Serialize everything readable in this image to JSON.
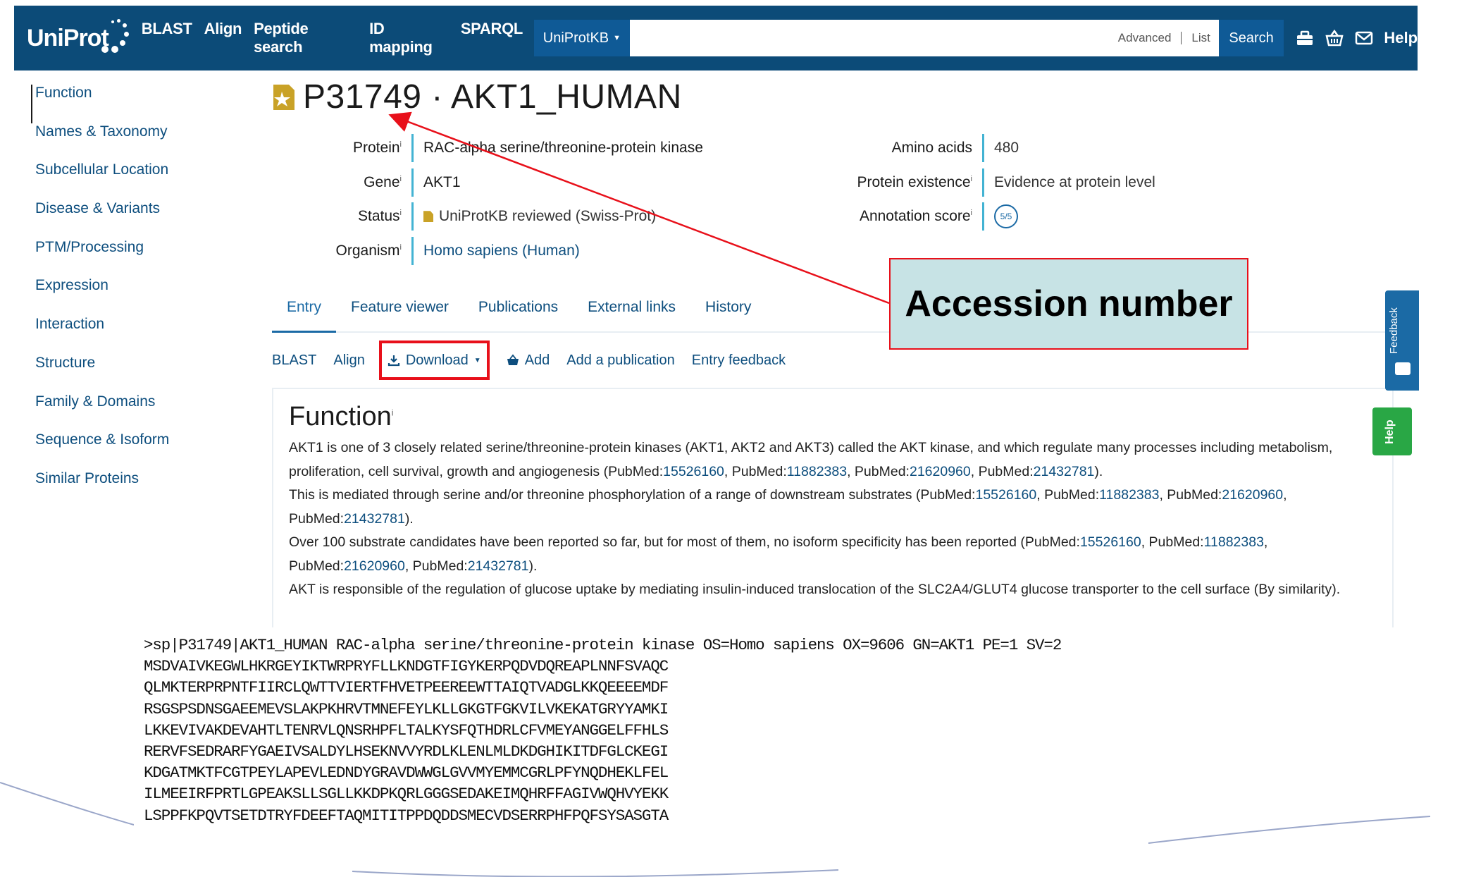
{
  "topbar": {
    "logo": "UniProt",
    "nav": [
      "BLAST",
      "Align",
      "Peptide search",
      "ID mapping",
      "SPARQL"
    ],
    "database": "UniProtKB",
    "search_value": "",
    "advanced": "Advanced",
    "list": "List",
    "search_button": "Search",
    "help": "Help"
  },
  "sidebar": {
    "items": [
      "Function",
      "Names & Taxonomy",
      "Subcellular Location",
      "Disease & Variants",
      "PTM/Processing",
      "Expression",
      "Interaction",
      "Structure",
      "Family & Domains",
      "Sequence & Isoform",
      "Similar Proteins"
    ]
  },
  "entry": {
    "title": "P31749 · AKT1_HUMAN",
    "left": [
      {
        "label": "Protein",
        "value": "RAC-alpha serine/threonine-protein kinase"
      },
      {
        "label": "Gene",
        "value": "AKT1"
      },
      {
        "label": "Status",
        "value": "UniProtKB reviewed (Swiss-Prot)"
      },
      {
        "label": "Organism",
        "value": "Homo sapiens (Human)"
      }
    ],
    "right": [
      {
        "label": "Amino acids",
        "value": "480"
      },
      {
        "label": "Protein existence",
        "value": "Evidence at protein level"
      },
      {
        "label": "Annotation score",
        "value": "5/5"
      }
    ]
  },
  "tabs": [
    "Entry",
    "Feature viewer",
    "Publications",
    "External links",
    "History"
  ],
  "toolbar": {
    "blast": "BLAST",
    "align": "Align",
    "download": "Download",
    "add": "Add",
    "add_publication": "Add a publication",
    "entry_feedback": "Entry feedback"
  },
  "function": {
    "heading": "Function",
    "paragraphs": [
      "AKT1 is one of 3 closely related serine/threonine-protein kinases (AKT1, AKT2 and AKT3) called the AKT kinase, and which regulate many processes including metabolism, proliferation, cell survival, growth and angiogenesis (PubMed:15526160, PubMed:11882383, PubMed:21620960, PubMed:21432781).",
      "This is mediated through serine and/or threonine phosphorylation of a range of downstream substrates (PubMed:15526160, PubMed:11882383, PubMed:21620960, PubMed:21432781).",
      "Over 100 substrate candidates have been reported so far, but for most of them, no isoform specificity has been reported (PubMed:15526160, PubMed:11882383, PubMed:21620960, PubMed:21432781).",
      "AKT is responsible of the regulation of glucose uptake by mediating insulin-induced translocation of the SLC2A4/GLUT4 glucose transporter to the cell surface (By similarity)."
    ]
  },
  "side_tabs": {
    "feedback": "Feedback",
    "help": "Help"
  },
  "annotation": {
    "label": "Accession number",
    "color": "#e8101a"
  },
  "fasta": {
    "header": ">sp|P31749|AKT1_HUMAN RAC-alpha serine/threonine-protein kinase OS=Homo sapiens OX=9606 GN=AKT1 PE=1 SV=2",
    "lines": [
      "MSDVAIVKEGWLHKRGEYIKTWRPRYFLLKNDGTFIGYKERPQDVDQREAPLNNFSVAQC",
      "QLMKTERPRPNTFIIRCLQWTTVIERTFHVETPEEREEWTTAIQTVADGLKKQEEEEMDF",
      "RSGSPSDNSGAEEMEVSLAKPKHRVTMNEFEYLKLLGKGTFGKVILVKEKATGRYYAMKI",
      "LKKEVIVAKDEVAHTLTENRVLQNSRHPFLTALKYSFQTHDRLCFVMEYANGGELFFHLS",
      "RERVFSEDRARFYGAEIVSALDYLHSEKNVVYRDLKLENLMLDKDGHIKITDFGLCKEGI",
      "KDGATMKTFCGTPEYLAPEVLEDNDYGRAVDWWGLGVVMYEMMCGRLPFYNQDHEKLFEL",
      "ILMEEIRFPRTLGPEAKSLLSGLLKKDPKQRLGGGSEDAKEIMQHRFFAGIVWQHVYEKK",
      "LSPPFKPQVTSETDTRYFDEEFTAQMITITPPDQDDSMECVDSERRPHFPQFSYSASGTA"
    ]
  },
  "colors": {
    "brand": "#0c4b78",
    "link": "#0d4e7e",
    "highlight": "#e8101a",
    "help_green": "#29a745"
  }
}
